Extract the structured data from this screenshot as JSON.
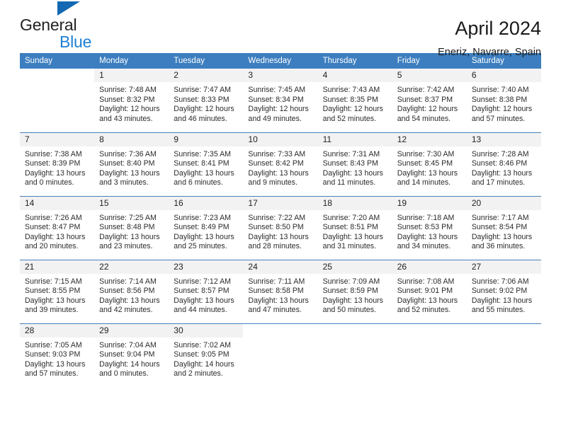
{
  "brand": {
    "name_line1": "General",
    "name_line2": "Blue",
    "triangle_color": "#1268b3",
    "blue_text_color": "#1e7fd4"
  },
  "header": {
    "title": "April 2024",
    "subtitle": "Eneriz, Navarre, Spain",
    "header_bg_color": "#3c7ebf",
    "daynum_bg_color": "#f2f2f2",
    "row_divider_color": "#4a7ebb"
  },
  "weekdays": [
    "Sunday",
    "Monday",
    "Tuesday",
    "Wednesday",
    "Thursday",
    "Friday",
    "Saturday"
  ],
  "weeks": [
    [
      {
        "day": "",
        "sunrise": "",
        "sunset": "",
        "daylight1": "",
        "daylight2": "",
        "empty": true
      },
      {
        "day": "1",
        "sunrise": "Sunrise: 7:48 AM",
        "sunset": "Sunset: 8:32 PM",
        "daylight1": "Daylight: 12 hours",
        "daylight2": "and 43 minutes."
      },
      {
        "day": "2",
        "sunrise": "Sunrise: 7:47 AM",
        "sunset": "Sunset: 8:33 PM",
        "daylight1": "Daylight: 12 hours",
        "daylight2": "and 46 minutes."
      },
      {
        "day": "3",
        "sunrise": "Sunrise: 7:45 AM",
        "sunset": "Sunset: 8:34 PM",
        "daylight1": "Daylight: 12 hours",
        "daylight2": "and 49 minutes."
      },
      {
        "day": "4",
        "sunrise": "Sunrise: 7:43 AM",
        "sunset": "Sunset: 8:35 PM",
        "daylight1": "Daylight: 12 hours",
        "daylight2": "and 52 minutes."
      },
      {
        "day": "5",
        "sunrise": "Sunrise: 7:42 AM",
        "sunset": "Sunset: 8:37 PM",
        "daylight1": "Daylight: 12 hours",
        "daylight2": "and 54 minutes."
      },
      {
        "day": "6",
        "sunrise": "Sunrise: 7:40 AM",
        "sunset": "Sunset: 8:38 PM",
        "daylight1": "Daylight: 12 hours",
        "daylight2": "and 57 minutes."
      }
    ],
    [
      {
        "day": "7",
        "sunrise": "Sunrise: 7:38 AM",
        "sunset": "Sunset: 8:39 PM",
        "daylight1": "Daylight: 13 hours",
        "daylight2": "and 0 minutes."
      },
      {
        "day": "8",
        "sunrise": "Sunrise: 7:36 AM",
        "sunset": "Sunset: 8:40 PM",
        "daylight1": "Daylight: 13 hours",
        "daylight2": "and 3 minutes."
      },
      {
        "day": "9",
        "sunrise": "Sunrise: 7:35 AM",
        "sunset": "Sunset: 8:41 PM",
        "daylight1": "Daylight: 13 hours",
        "daylight2": "and 6 minutes."
      },
      {
        "day": "10",
        "sunrise": "Sunrise: 7:33 AM",
        "sunset": "Sunset: 8:42 PM",
        "daylight1": "Daylight: 13 hours",
        "daylight2": "and 9 minutes."
      },
      {
        "day": "11",
        "sunrise": "Sunrise: 7:31 AM",
        "sunset": "Sunset: 8:43 PM",
        "daylight1": "Daylight: 13 hours",
        "daylight2": "and 11 minutes."
      },
      {
        "day": "12",
        "sunrise": "Sunrise: 7:30 AM",
        "sunset": "Sunset: 8:45 PM",
        "daylight1": "Daylight: 13 hours",
        "daylight2": "and 14 minutes."
      },
      {
        "day": "13",
        "sunrise": "Sunrise: 7:28 AM",
        "sunset": "Sunset: 8:46 PM",
        "daylight1": "Daylight: 13 hours",
        "daylight2": "and 17 minutes."
      }
    ],
    [
      {
        "day": "14",
        "sunrise": "Sunrise: 7:26 AM",
        "sunset": "Sunset: 8:47 PM",
        "daylight1": "Daylight: 13 hours",
        "daylight2": "and 20 minutes."
      },
      {
        "day": "15",
        "sunrise": "Sunrise: 7:25 AM",
        "sunset": "Sunset: 8:48 PM",
        "daylight1": "Daylight: 13 hours",
        "daylight2": "and 23 minutes."
      },
      {
        "day": "16",
        "sunrise": "Sunrise: 7:23 AM",
        "sunset": "Sunset: 8:49 PM",
        "daylight1": "Daylight: 13 hours",
        "daylight2": "and 25 minutes."
      },
      {
        "day": "17",
        "sunrise": "Sunrise: 7:22 AM",
        "sunset": "Sunset: 8:50 PM",
        "daylight1": "Daylight: 13 hours",
        "daylight2": "and 28 minutes."
      },
      {
        "day": "18",
        "sunrise": "Sunrise: 7:20 AM",
        "sunset": "Sunset: 8:51 PM",
        "daylight1": "Daylight: 13 hours",
        "daylight2": "and 31 minutes."
      },
      {
        "day": "19",
        "sunrise": "Sunrise: 7:18 AM",
        "sunset": "Sunset: 8:53 PM",
        "daylight1": "Daylight: 13 hours",
        "daylight2": "and 34 minutes."
      },
      {
        "day": "20",
        "sunrise": "Sunrise: 7:17 AM",
        "sunset": "Sunset: 8:54 PM",
        "daylight1": "Daylight: 13 hours",
        "daylight2": "and 36 minutes."
      }
    ],
    [
      {
        "day": "21",
        "sunrise": "Sunrise: 7:15 AM",
        "sunset": "Sunset: 8:55 PM",
        "daylight1": "Daylight: 13 hours",
        "daylight2": "and 39 minutes."
      },
      {
        "day": "22",
        "sunrise": "Sunrise: 7:14 AM",
        "sunset": "Sunset: 8:56 PM",
        "daylight1": "Daylight: 13 hours",
        "daylight2": "and 42 minutes."
      },
      {
        "day": "23",
        "sunrise": "Sunrise: 7:12 AM",
        "sunset": "Sunset: 8:57 PM",
        "daylight1": "Daylight: 13 hours",
        "daylight2": "and 44 minutes."
      },
      {
        "day": "24",
        "sunrise": "Sunrise: 7:11 AM",
        "sunset": "Sunset: 8:58 PM",
        "daylight1": "Daylight: 13 hours",
        "daylight2": "and 47 minutes."
      },
      {
        "day": "25",
        "sunrise": "Sunrise: 7:09 AM",
        "sunset": "Sunset: 8:59 PM",
        "daylight1": "Daylight: 13 hours",
        "daylight2": "and 50 minutes."
      },
      {
        "day": "26",
        "sunrise": "Sunrise: 7:08 AM",
        "sunset": "Sunset: 9:01 PM",
        "daylight1": "Daylight: 13 hours",
        "daylight2": "and 52 minutes."
      },
      {
        "day": "27",
        "sunrise": "Sunrise: 7:06 AM",
        "sunset": "Sunset: 9:02 PM",
        "daylight1": "Daylight: 13 hours",
        "daylight2": "and 55 minutes."
      }
    ],
    [
      {
        "day": "28",
        "sunrise": "Sunrise: 7:05 AM",
        "sunset": "Sunset: 9:03 PM",
        "daylight1": "Daylight: 13 hours",
        "daylight2": "and 57 minutes."
      },
      {
        "day": "29",
        "sunrise": "Sunrise: 7:04 AM",
        "sunset": "Sunset: 9:04 PM",
        "daylight1": "Daylight: 14 hours",
        "daylight2": "and 0 minutes."
      },
      {
        "day": "30",
        "sunrise": "Sunrise: 7:02 AM",
        "sunset": "Sunset: 9:05 PM",
        "daylight1": "Daylight: 14 hours",
        "daylight2": "and 2 minutes."
      },
      {
        "day": "",
        "sunrise": "",
        "sunset": "",
        "daylight1": "",
        "daylight2": "",
        "empty": true
      },
      {
        "day": "",
        "sunrise": "",
        "sunset": "",
        "daylight1": "",
        "daylight2": "",
        "empty": true
      },
      {
        "day": "",
        "sunrise": "",
        "sunset": "",
        "daylight1": "",
        "daylight2": "",
        "empty": true
      },
      {
        "day": "",
        "sunrise": "",
        "sunset": "",
        "daylight1": "",
        "daylight2": "",
        "empty": true
      }
    ]
  ]
}
